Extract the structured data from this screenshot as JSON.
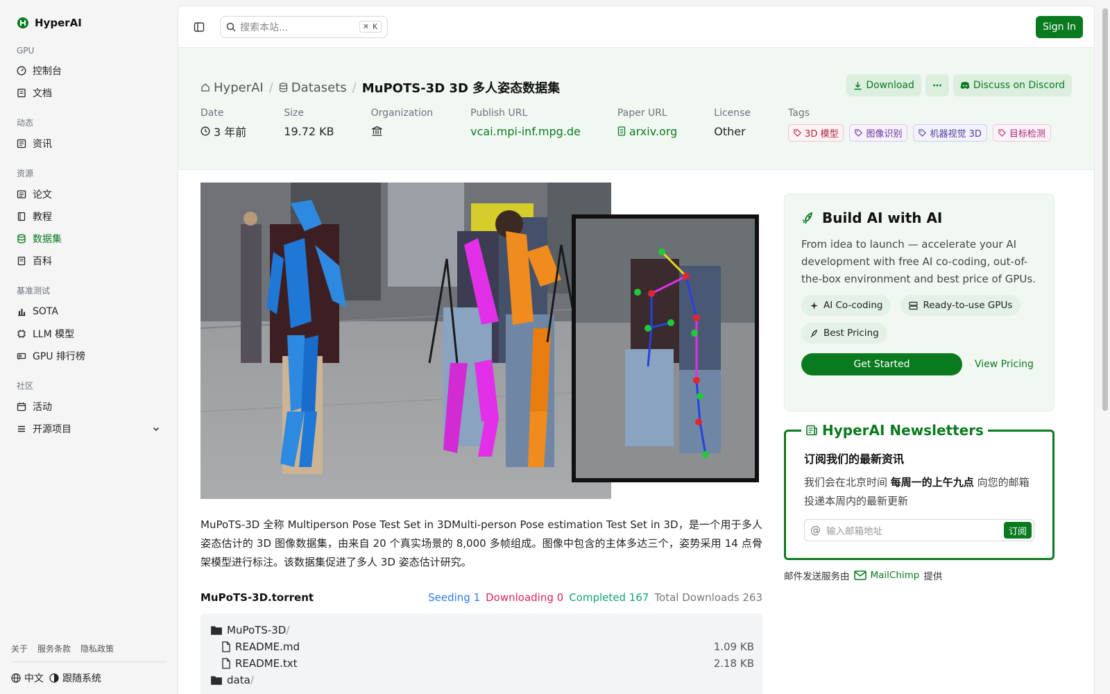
{
  "brand": {
    "name": "HyperAI"
  },
  "sidebar": {
    "sections": [
      {
        "title": "GPU",
        "items": [
          {
            "label": "控制台",
            "icon": "gauge-icon"
          },
          {
            "label": "文档",
            "icon": "doc-icon"
          }
        ]
      },
      {
        "title": "动态",
        "items": [
          {
            "label": "资讯",
            "icon": "news-icon"
          }
        ]
      },
      {
        "title": "资源",
        "items": [
          {
            "label": "论文",
            "icon": "paper-icon"
          },
          {
            "label": "教程",
            "icon": "book-icon"
          },
          {
            "label": "数据集",
            "icon": "database-icon",
            "active": true
          },
          {
            "label": "百科",
            "icon": "wiki-icon"
          }
        ]
      },
      {
        "title": "基准测试",
        "items": [
          {
            "label": "SOTA",
            "icon": "chart-icon"
          },
          {
            "label": "LLM 模型",
            "icon": "chip-icon"
          },
          {
            "label": "GPU 排行榜",
            "icon": "gpu-icon"
          }
        ]
      },
      {
        "title": "社区",
        "items": [
          {
            "label": "活动",
            "icon": "event-icon"
          },
          {
            "label": "开源项目",
            "icon": "list-icon"
          }
        ]
      }
    ],
    "footer_links": [
      "关于",
      "服务条款",
      "隐私政策"
    ],
    "language": "中文",
    "theme": "跟随系统"
  },
  "topbar": {
    "search_placeholder": "搜索本站...",
    "shortcut": "⌘ K",
    "signin": "Sign In"
  },
  "header": {
    "crumbs": [
      "HyperAI",
      "Datasets"
    ],
    "title": "MuPOTS-3D 3D 多人姿态数据集",
    "download": "Download",
    "discord": "Discuss on Discord",
    "meta": {
      "date_label": "Date",
      "date_value": "3 年前",
      "size_label": "Size",
      "size_value": "19.72 KB",
      "org_label": "Organization",
      "publish_label": "Publish URL",
      "publish_value": "vcai.mpi-inf.mpg.de",
      "paper_label": "Paper URL",
      "paper_value": "arxiv.org",
      "license_label": "License",
      "license_value": "Other",
      "tags_label": "Tags",
      "tags": [
        "3D 模型",
        "图像识别",
        "机器视觉 3D",
        "目标检测"
      ]
    }
  },
  "content": {
    "description": "MuPoTS-3D 全称 Multiperson Pose Test Set in 3DMulti-person Pose estimation Test Set in 3D，是一个用于多人姿态估计的 3D 图像数据集，由来自 20 个真实场景的 8,000 多帧组成。图像中包含的主体多达三个，姿势采用 14 点骨架模型进行标注。该数据集促进了多人 3D 姿态估计研究。",
    "torrent": {
      "name": "MuPoTS-3D.torrent",
      "seeding": "Seeding 1",
      "downloading": "Downloading 0",
      "completed": "Completed 167",
      "total": "Total Downloads 263",
      "files": [
        {
          "name": "MuPoTS-3D",
          "slash": "/",
          "size": "",
          "type": "folder",
          "indent": false
        },
        {
          "name": "README.md",
          "slash": "",
          "size": "1.09 KB",
          "type": "file",
          "indent": true
        },
        {
          "name": "README.txt",
          "slash": "",
          "size": "2.18 KB",
          "type": "file",
          "indent": true
        },
        {
          "name": "data",
          "slash": "/",
          "size": "",
          "type": "folder",
          "indent": false
        }
      ]
    }
  },
  "promo": {
    "title": "Build AI with AI",
    "text": "From idea to launch — accelerate your AI development with free AI co-coding, out-of-the-box environment and best price of GPUs.",
    "chips": [
      "AI Co-coding",
      "Ready-to-use GPUs",
      "Best Pricing"
    ],
    "cta": "Get Started",
    "link": "View Pricing"
  },
  "newsletter": {
    "title": "HyperAI Newsletters",
    "subtitle": "订阅我们的最新资讯",
    "text_pre": "我们会在北京时间 ",
    "text_bold": "每周一的上午九点",
    "text_post": " 向您的邮箱投递本周内的最新更新",
    "email_placeholder": "输入邮箱地址",
    "subscribe": "订阅",
    "provider_pre": "邮件发送服务由",
    "provider": "MailChimp",
    "provider_post": "提供"
  },
  "colors": {
    "accent": "#0a7a1f",
    "header_bg": "#f1f8f2"
  }
}
